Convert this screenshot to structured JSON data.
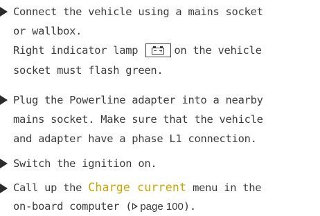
{
  "steps": [
    {
      "lines": [
        "Connect the vehicle using a mains socket",
        "or wallbox."
      ],
      "note_before_icon": "Right indicator lamp",
      "icon": "battery-icon",
      "note_after_icon": "on the vehicle",
      "note_line2": "socket must flash green."
    },
    {
      "lines": [
        "Plug the Powerline adapter into a nearby",
        "mains socket. Make sure that the vehicle",
        "and adapter have a phase L1 connection."
      ]
    },
    {
      "lines": [
        "Switch the ignition on."
      ]
    },
    {
      "pre": "Call up the",
      "menu_name": "Charge current",
      "post": "menu in the",
      "line2_pre": "on-board computer (",
      "ref_icon": "page-reference-icon",
      "page_ref": "page 100",
      "line2_post": ")."
    }
  ],
  "colors": {
    "text": "#3a3a3a",
    "highlight": "#c9a400"
  }
}
